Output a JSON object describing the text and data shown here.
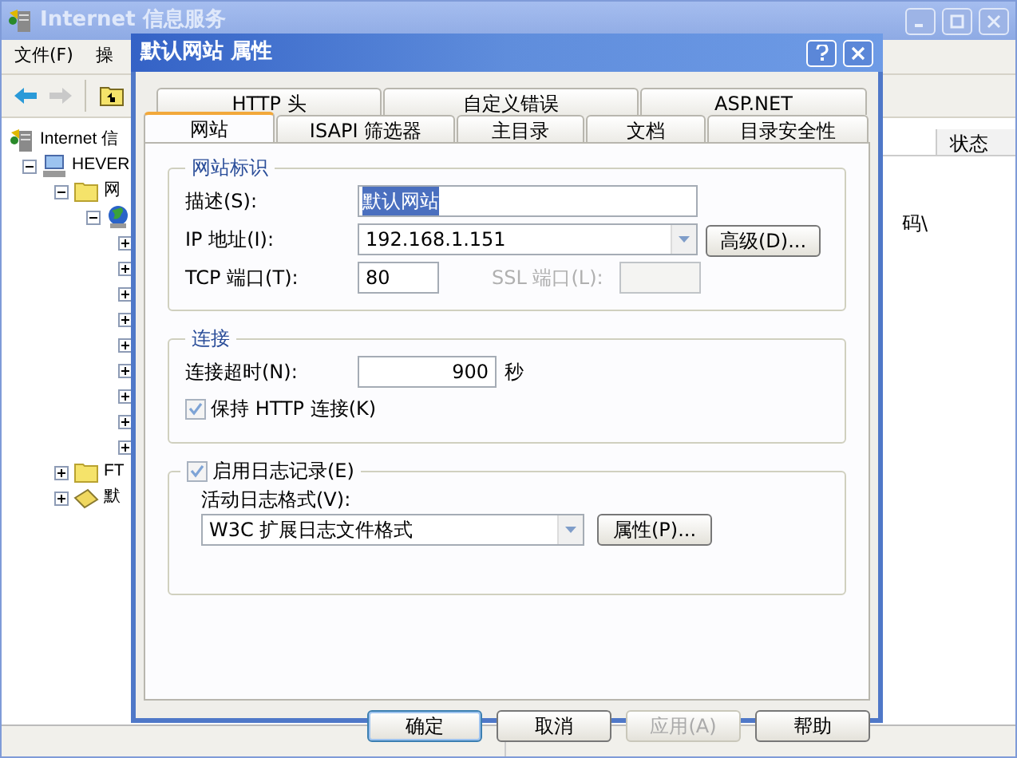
{
  "main_window": {
    "title": "Internet 信息服务",
    "menu": [
      "文件(F)",
      "操"
    ],
    "tree": [
      {
        "label": "Internet 信",
        "kind": "server",
        "children": [
          {
            "label": "HEVER",
            "kind": "computer",
            "expanded": true,
            "children": [
              {
                "label": "网",
                "kind": "folder",
                "expanded": true,
                "children": [
                  {
                    "kind": "globe",
                    "expanded": true,
                    "children": [
                      {
                        "expanded": false
                      },
                      {
                        "expanded": false
                      },
                      {
                        "expanded": false
                      },
                      {
                        "expanded": false
                      },
                      {
                        "expanded": false
                      },
                      {
                        "expanded": false
                      },
                      {
                        "expanded": false
                      },
                      {
                        "expanded": false
                      },
                      {
                        "expanded": false
                      }
                    ]
                  }
                ]
              },
              {
                "label": "FT",
                "kind": "folder",
                "expanded": false
              },
              {
                "label": "默",
                "kind": "smtp",
                "expanded": false
              }
            ]
          }
        ]
      }
    ],
    "columns": [
      "状态"
    ],
    "cell_text": "码\\"
  },
  "dialog": {
    "title": "默认网站 属性",
    "tab_rows": [
      [
        {
          "label": "HTTP 头",
          "selected": false
        },
        {
          "label": "自定义错误",
          "selected": false
        },
        {
          "label": "ASP.NET",
          "selected": false
        }
      ],
      [
        {
          "label": "网站",
          "selected": true
        },
        {
          "label": "ISAPI 筛选器",
          "selected": false
        },
        {
          "label": "主目录",
          "selected": false
        },
        {
          "label": "文档",
          "selected": false
        },
        {
          "label": "目录安全性",
          "selected": false
        }
      ]
    ],
    "identity": {
      "legend": "网站标识",
      "description_label": "描述(S):",
      "description": "默认网站",
      "ip_label": "IP 地址(I):",
      "ip": "192.168.1.151",
      "advanced_button": "高级(D)...",
      "tcp_label": "TCP 端口(T):",
      "tcp": "80",
      "ssl_label": "SSL 端口(L):",
      "ssl_disabled": true
    },
    "connection": {
      "legend": "连接",
      "timeout_label": "连接超时(N):",
      "timeout": "900",
      "unit": "秒",
      "keep_alive_label": "保持 HTTP 连接(K)",
      "keep_alive": true
    },
    "logging": {
      "label": "启用日志记录(E)",
      "enabled": true,
      "format_label": "活动日志格式(V):",
      "format": "W3C 扩展日志文件格式",
      "properties_button": "属性(P)..."
    },
    "buttons": [
      {
        "label": "确定",
        "default": true,
        "disabled": false
      },
      {
        "label": "取消",
        "default": false,
        "disabled": false
      },
      {
        "label": "应用(A)",
        "default": false,
        "disabled": true
      },
      {
        "label": "帮助",
        "default": false,
        "disabled": false
      }
    ]
  }
}
